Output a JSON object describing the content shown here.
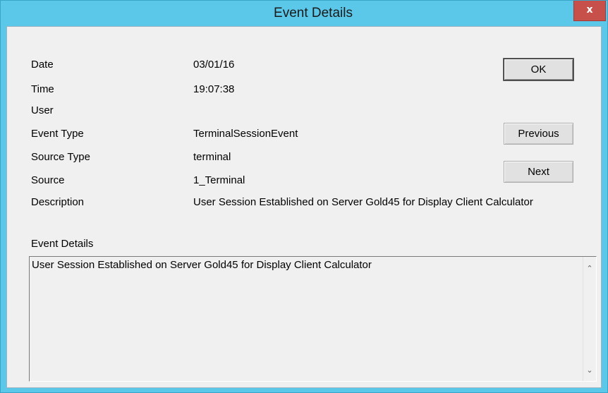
{
  "window": {
    "title": "Event Details",
    "close_label": "x"
  },
  "fields": {
    "date_label": "Date",
    "date_value": "03/01/16",
    "time_label": "Time",
    "time_value": "19:07:38",
    "user_label": "User",
    "user_value": "",
    "event_type_label": "Event Type",
    "event_type_value": "TerminalSessionEvent",
    "source_type_label": "Source Type",
    "source_type_value": "terminal",
    "source_label": "Source",
    "source_value": "1_Terminal",
    "description_label": "Description",
    "description_value": "User Session Established on Server Gold45 for Display Client Calculator"
  },
  "buttons": {
    "ok": "OK",
    "previous": "Previous",
    "next": "Next"
  },
  "event_details": {
    "label": "Event Details",
    "text": "User Session Established on Server Gold45 for Display Client Calculator"
  },
  "icons": {
    "close": "close-icon",
    "scroll_up": "chevron-up-icon",
    "scroll_down": "chevron-down-icon"
  },
  "colors": {
    "titlebar": "#5bc8ea",
    "close_button": "#c7504a",
    "dialog_background": "#f0f0f0"
  }
}
